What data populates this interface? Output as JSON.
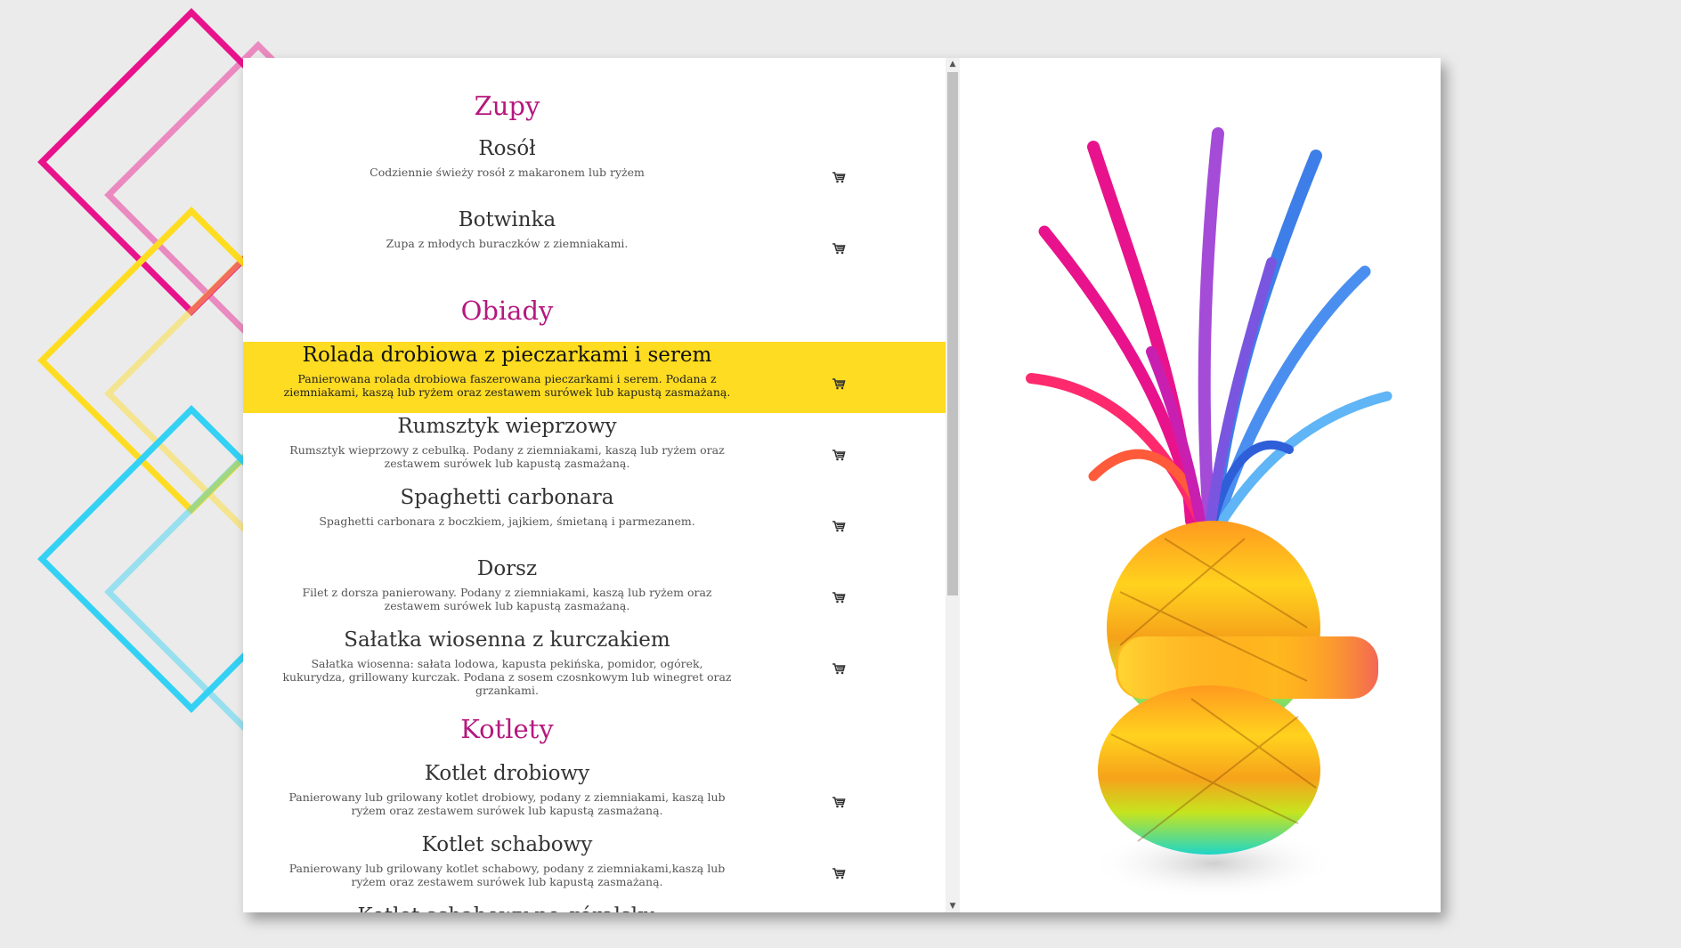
{
  "menu": {
    "sections": [
      {
        "title": "Zupy",
        "items": [
          {
            "name": "Rosół",
            "desc": "Codziennie świeży rosół z makaronem lub ryżem"
          },
          {
            "name": "Botwinka",
            "desc": "Zupa z młodych buraczków z ziemniakami."
          }
        ]
      },
      {
        "title": "Obiady",
        "items": [
          {
            "name": "Rolada drobiowa z pieczarkami i serem",
            "desc": "Panierowana rolada drobiowa faszerowana pieczarkami i serem. Podana z ziemniakami, kaszą lub ryżem oraz zestawem surówek lub kapustą zasmażaną."
          },
          {
            "name": "Rumsztyk wieprzowy",
            "desc": "Rumsztyk wieprzowy z cebulką. Podany z ziemniakami, kaszą lub ryżem oraz zestawem surówek lub kapustą zasmażaną."
          },
          {
            "name": "Spaghetti carbonara",
            "desc": "Spaghetti carbonara z boczkiem, jajkiem, śmietaną i parmezanem."
          },
          {
            "name": "Dorsz",
            "desc": "Filet z dorsza panierowany. Podany z ziemniakami, kaszą lub ryżem oraz zestawem surówek lub kapustą zasmażaną."
          },
          {
            "name": "Sałatka wiosenna z kurczakiem",
            "desc": "Sałatka wiosenna: sałata lodowa, kapusta pekińska, pomidor, ogórek, kukurydza, grillowany kurczak. Podana z sosem czosnkowym lub winegret oraz grzankami."
          }
        ]
      },
      {
        "title": "Kotlety",
        "items": [
          {
            "name": "Kotlet drobiowy",
            "desc": "Panierowany lub grilowany kotlet drobiowy, podany z ziemniakami, kaszą lub ryżem oraz zestawem surówek lub kapustą zasmażaną."
          },
          {
            "name": "Kotlet schabowy",
            "desc": "Panierowany lub grilowany kotlet schabowy, podany z ziemniakami,kaszą lub ryżem oraz zestawem surówek lub kapustą zasmażaną."
          },
          {
            "name": "Kotlet schabowy po góralsku",
            "desc": ""
          }
        ]
      }
    ]
  },
  "icons": {
    "cart": "cart-icon",
    "scroll_up": "scroll-up-arrow-icon",
    "scroll_down": "scroll-down-arrow-icon"
  },
  "colors": {
    "section_title": "#b5187e",
    "highlight": "#fedc21",
    "deco_magenta": "#e8138c",
    "deco_yellow": "#fedc21",
    "deco_cyan": "#33d1f4"
  }
}
